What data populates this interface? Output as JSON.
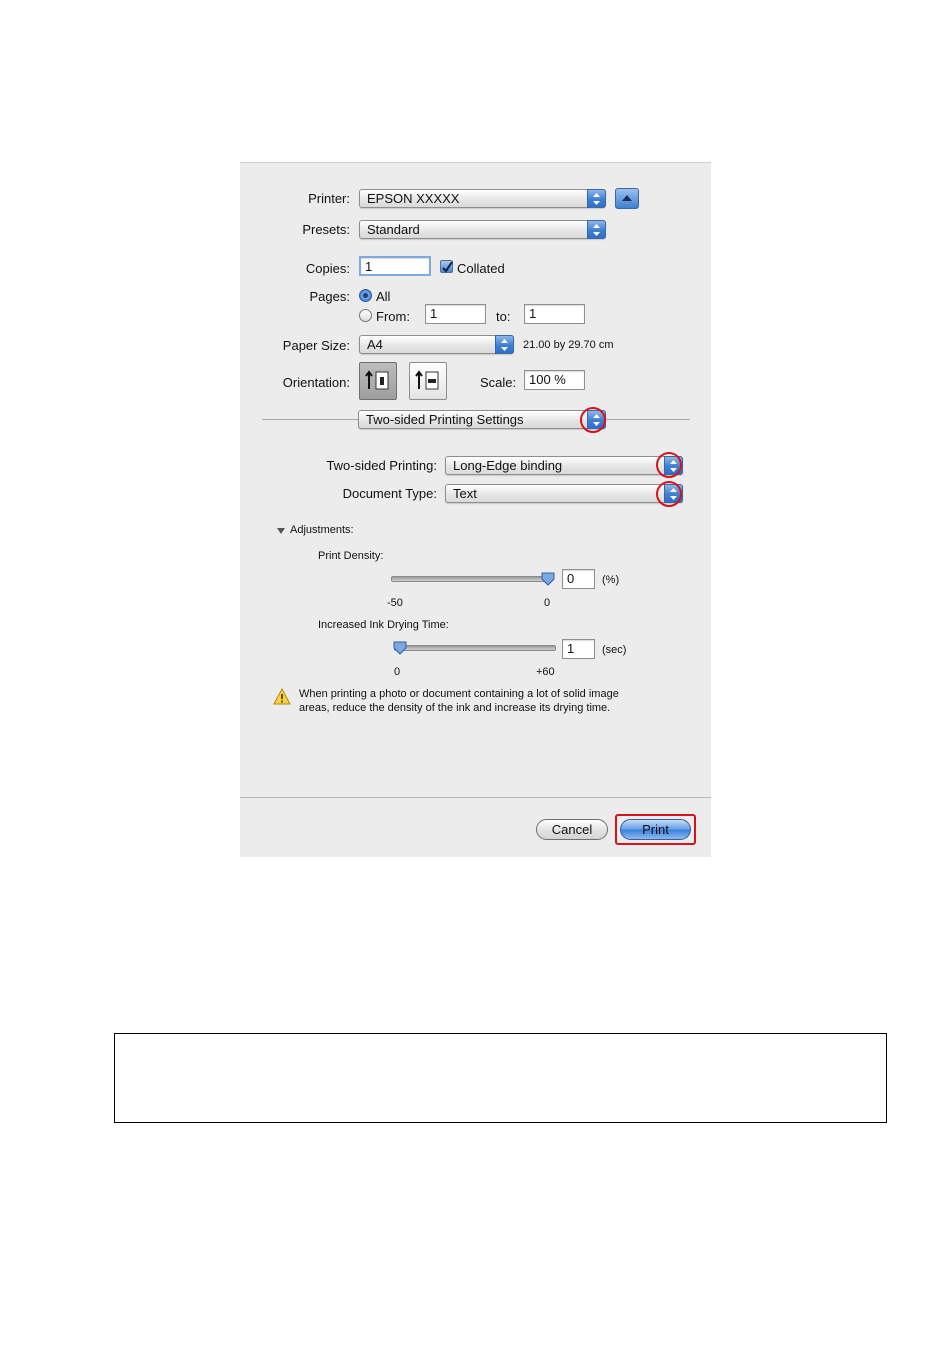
{
  "dialog": {
    "printer": {
      "label": "Printer:",
      "value": "EPSON XXXXX"
    },
    "presets": {
      "label": "Presets:",
      "value": "Standard"
    },
    "copies": {
      "label": "Copies:",
      "value": "1",
      "collated_label": "Collated",
      "collated_checked": true
    },
    "pages": {
      "label": "Pages:",
      "all_label": "All",
      "from_label": "From:",
      "from_value": "1",
      "to_label": "to:",
      "to_value": "1",
      "selected": "All"
    },
    "paper_size": {
      "label": "Paper Size:",
      "value": "A4",
      "dimensions": "21.00 by 29.70 cm"
    },
    "orientation": {
      "label": "Orientation:",
      "selected": "portrait"
    },
    "scale": {
      "label": "Scale:",
      "value": "100 %"
    },
    "panel_menu": {
      "value": "Two-sided Printing Settings"
    },
    "two_sided": {
      "label": "Two-sided Printing:",
      "value": "Long-Edge binding"
    },
    "document_type": {
      "label": "Document Type:",
      "value": "Text"
    },
    "adjustments": {
      "label": "Adjustments:",
      "print_density": {
        "label": "Print Density:",
        "value": "0",
        "unit": "(%)",
        "min_label": "-50",
        "max_label": "0",
        "min": -50,
        "max": 0,
        "current": 0
      },
      "drying_time": {
        "label": "Increased Ink Drying Time:",
        "value": "1",
        "unit": "(sec)",
        "min_label": "0",
        "max_label": "+60",
        "min": 0,
        "max": 60,
        "current": 1
      }
    },
    "warning": {
      "line1": "When printing a photo or document containing a lot of solid image",
      "line2": "areas, reduce the density of the ink and increase its drying time."
    },
    "buttons": {
      "cancel": "Cancel",
      "print": "Print"
    }
  },
  "colors": {
    "highlight": "#d4141c",
    "accent": "#3f7fd3",
    "dialog_bg": "#ececec"
  },
  "icons": [
    "popup-arrows-icon",
    "disclosure-up-icon",
    "portrait-icon",
    "landscape-icon",
    "disclosure-triangle-icon",
    "warning-icon"
  ]
}
